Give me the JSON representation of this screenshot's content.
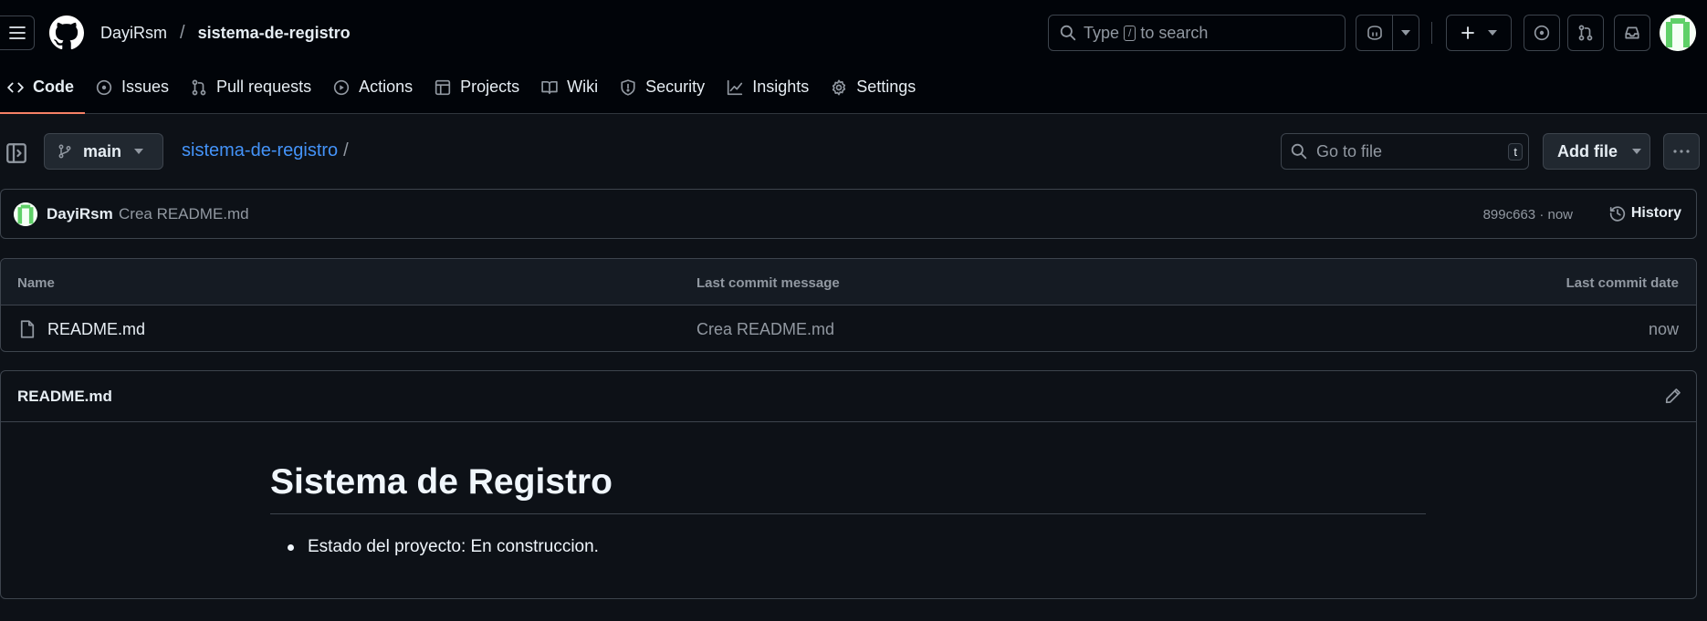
{
  "header": {
    "owner": "DayiRsm",
    "separator": "/",
    "repo": "sistema-de-registro",
    "search": {
      "prefix": "Type",
      "key": "/",
      "suffix": "to search"
    }
  },
  "nav": {
    "tabs": [
      {
        "label": "Code",
        "icon": "code-icon",
        "active": true
      },
      {
        "label": "Issues",
        "icon": "issue-opened-icon"
      },
      {
        "label": "Pull requests",
        "icon": "git-pull-request-icon"
      },
      {
        "label": "Actions",
        "icon": "play-icon"
      },
      {
        "label": "Projects",
        "icon": "table-icon"
      },
      {
        "label": "Wiki",
        "icon": "book-icon"
      },
      {
        "label": "Security",
        "icon": "shield-icon"
      },
      {
        "label": "Insights",
        "icon": "graph-icon"
      },
      {
        "label": "Settings",
        "icon": "gear-icon"
      }
    ]
  },
  "subheader": {
    "branch": "main",
    "path_repo": "sistema-de-registro",
    "path_sep": "/",
    "goto_placeholder": "Go to file",
    "goto_key": "t",
    "add_file_label": "Add file"
  },
  "commit": {
    "author": "DayiRsm",
    "message": "Crea README.md",
    "meta": "899c663 · now",
    "history_label": "History"
  },
  "files": {
    "columns": [
      "Name",
      "Last commit message",
      "Last commit date"
    ],
    "rows": [
      {
        "name": "README.md",
        "message": "Crea README.md",
        "date": "now"
      }
    ]
  },
  "readme": {
    "filename": "README.md",
    "heading": "Sistema de Registro",
    "items": [
      "Estado del proyecto: En construccion."
    ]
  },
  "colors": {
    "background": "#0d1117",
    "header_bg": "#010409",
    "accent_tab": "#f78166",
    "link": "#4493f8",
    "avatar_green": "#5fd068"
  }
}
